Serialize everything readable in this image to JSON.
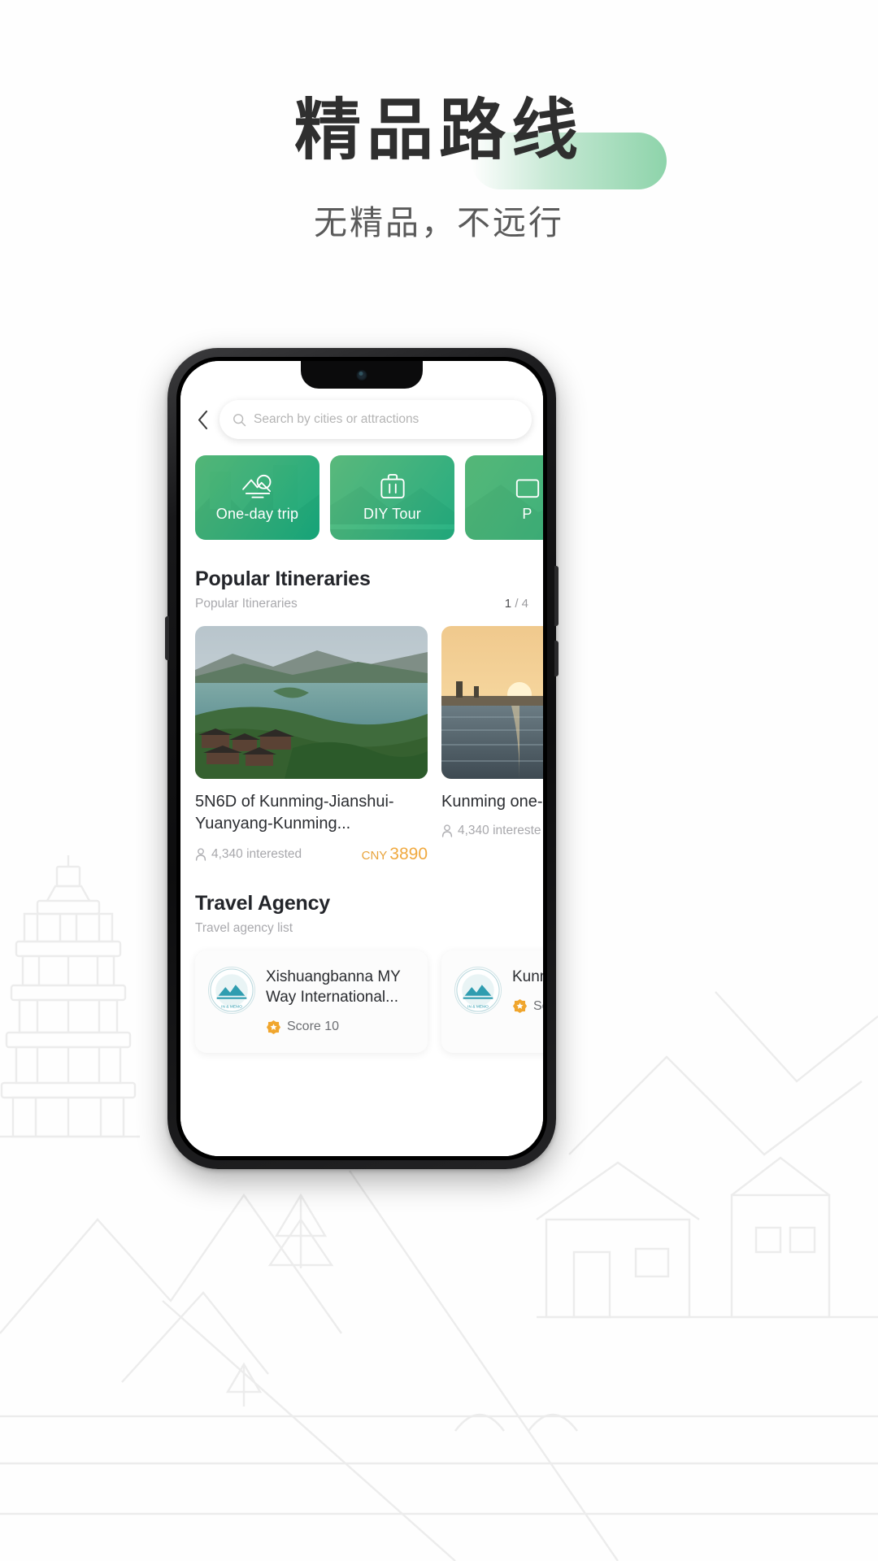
{
  "header": {
    "title": "精品路线",
    "subtitle": "无精品，不远行",
    "highlight_color": "#84d0a3"
  },
  "phone": {
    "app": {
      "topbar": {
        "back_icon": "chevron-left-icon",
        "search_icon": "search-icon",
        "search_placeholder": "Search by cities or attractions",
        "search_value": ""
      },
      "categories": [
        {
          "label": "One-day trip",
          "icon": "mountain-photo-icon"
        },
        {
          "label": "DIY Tour",
          "icon": "suitcase-icon"
        },
        {
          "label": "P",
          "icon": "package-icon"
        }
      ],
      "sections": [
        {
          "title": "Popular Itineraries",
          "subtitle": "Popular Itineraries",
          "count_current": "1",
          "count_sep": "/",
          "count_total": "4",
          "items": [
            {
              "title": "5N6D of Kunming-Jianshui-Yuanyang-Kunming...",
              "interested": "4,340 interested",
              "person_icon": "person-icon",
              "currency": "CNY",
              "price": "3890"
            },
            {
              "title": "Kunming one-...",
              "interested": "4,340 intereste",
              "person_icon": "person-icon",
              "currency": "",
              "price": ""
            }
          ]
        },
        {
          "title": "Travel Agency",
          "subtitle": "Travel agency list",
          "items": [
            {
              "name": "Xishuangbanna MY Way International...",
              "score_icon": "star-badge-icon",
              "score_label": "Score 10",
              "logo_alt": "agency-logo-icon"
            },
            {
              "name": "Kunm... Inter...",
              "score_icon": "star-badge-icon",
              "score_label": "Sc",
              "logo_alt": "agency-logo-icon"
            }
          ]
        }
      ]
    }
  }
}
